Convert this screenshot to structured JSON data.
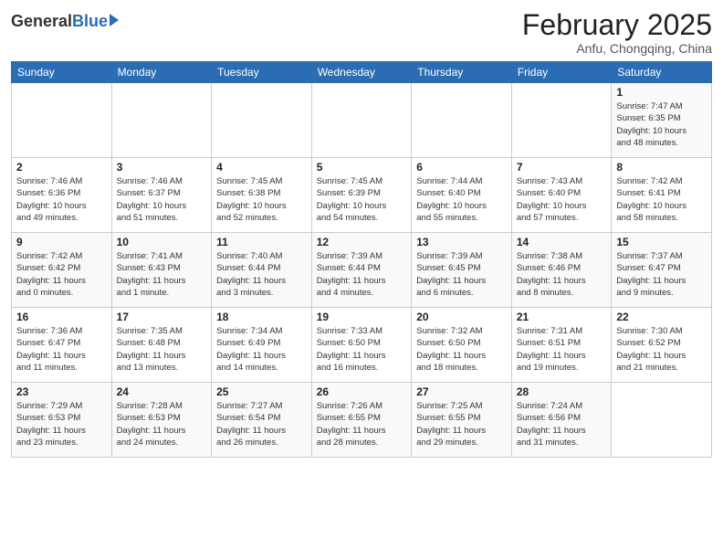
{
  "header": {
    "logo_general": "General",
    "logo_blue": "Blue",
    "month_title": "February 2025",
    "location": "Anfu, Chongqing, China"
  },
  "weekdays": [
    "Sunday",
    "Monday",
    "Tuesday",
    "Wednesday",
    "Thursday",
    "Friday",
    "Saturday"
  ],
  "weeks": [
    [
      {
        "day": "",
        "info": ""
      },
      {
        "day": "",
        "info": ""
      },
      {
        "day": "",
        "info": ""
      },
      {
        "day": "",
        "info": ""
      },
      {
        "day": "",
        "info": ""
      },
      {
        "day": "",
        "info": ""
      },
      {
        "day": "1",
        "info": "Sunrise: 7:47 AM\nSunset: 6:35 PM\nDaylight: 10 hours\nand 48 minutes."
      }
    ],
    [
      {
        "day": "2",
        "info": "Sunrise: 7:46 AM\nSunset: 6:36 PM\nDaylight: 10 hours\nand 49 minutes."
      },
      {
        "day": "3",
        "info": "Sunrise: 7:46 AM\nSunset: 6:37 PM\nDaylight: 10 hours\nand 51 minutes."
      },
      {
        "day": "4",
        "info": "Sunrise: 7:45 AM\nSunset: 6:38 PM\nDaylight: 10 hours\nand 52 minutes."
      },
      {
        "day": "5",
        "info": "Sunrise: 7:45 AM\nSunset: 6:39 PM\nDaylight: 10 hours\nand 54 minutes."
      },
      {
        "day": "6",
        "info": "Sunrise: 7:44 AM\nSunset: 6:40 PM\nDaylight: 10 hours\nand 55 minutes."
      },
      {
        "day": "7",
        "info": "Sunrise: 7:43 AM\nSunset: 6:40 PM\nDaylight: 10 hours\nand 57 minutes."
      },
      {
        "day": "8",
        "info": "Sunrise: 7:42 AM\nSunset: 6:41 PM\nDaylight: 10 hours\nand 58 minutes."
      }
    ],
    [
      {
        "day": "9",
        "info": "Sunrise: 7:42 AM\nSunset: 6:42 PM\nDaylight: 11 hours\nand 0 minutes."
      },
      {
        "day": "10",
        "info": "Sunrise: 7:41 AM\nSunset: 6:43 PM\nDaylight: 11 hours\nand 1 minute."
      },
      {
        "day": "11",
        "info": "Sunrise: 7:40 AM\nSunset: 6:44 PM\nDaylight: 11 hours\nand 3 minutes."
      },
      {
        "day": "12",
        "info": "Sunrise: 7:39 AM\nSunset: 6:44 PM\nDaylight: 11 hours\nand 4 minutes."
      },
      {
        "day": "13",
        "info": "Sunrise: 7:39 AM\nSunset: 6:45 PM\nDaylight: 11 hours\nand 6 minutes."
      },
      {
        "day": "14",
        "info": "Sunrise: 7:38 AM\nSunset: 6:46 PM\nDaylight: 11 hours\nand 8 minutes."
      },
      {
        "day": "15",
        "info": "Sunrise: 7:37 AM\nSunset: 6:47 PM\nDaylight: 11 hours\nand 9 minutes."
      }
    ],
    [
      {
        "day": "16",
        "info": "Sunrise: 7:36 AM\nSunset: 6:47 PM\nDaylight: 11 hours\nand 11 minutes."
      },
      {
        "day": "17",
        "info": "Sunrise: 7:35 AM\nSunset: 6:48 PM\nDaylight: 11 hours\nand 13 minutes."
      },
      {
        "day": "18",
        "info": "Sunrise: 7:34 AM\nSunset: 6:49 PM\nDaylight: 11 hours\nand 14 minutes."
      },
      {
        "day": "19",
        "info": "Sunrise: 7:33 AM\nSunset: 6:50 PM\nDaylight: 11 hours\nand 16 minutes."
      },
      {
        "day": "20",
        "info": "Sunrise: 7:32 AM\nSunset: 6:50 PM\nDaylight: 11 hours\nand 18 minutes."
      },
      {
        "day": "21",
        "info": "Sunrise: 7:31 AM\nSunset: 6:51 PM\nDaylight: 11 hours\nand 19 minutes."
      },
      {
        "day": "22",
        "info": "Sunrise: 7:30 AM\nSunset: 6:52 PM\nDaylight: 11 hours\nand 21 minutes."
      }
    ],
    [
      {
        "day": "23",
        "info": "Sunrise: 7:29 AM\nSunset: 6:53 PM\nDaylight: 11 hours\nand 23 minutes."
      },
      {
        "day": "24",
        "info": "Sunrise: 7:28 AM\nSunset: 6:53 PM\nDaylight: 11 hours\nand 24 minutes."
      },
      {
        "day": "25",
        "info": "Sunrise: 7:27 AM\nSunset: 6:54 PM\nDaylight: 11 hours\nand 26 minutes."
      },
      {
        "day": "26",
        "info": "Sunrise: 7:26 AM\nSunset: 6:55 PM\nDaylight: 11 hours\nand 28 minutes."
      },
      {
        "day": "27",
        "info": "Sunrise: 7:25 AM\nSunset: 6:55 PM\nDaylight: 11 hours\nand 29 minutes."
      },
      {
        "day": "28",
        "info": "Sunrise: 7:24 AM\nSunset: 6:56 PM\nDaylight: 11 hours\nand 31 minutes."
      },
      {
        "day": "",
        "info": ""
      }
    ]
  ]
}
